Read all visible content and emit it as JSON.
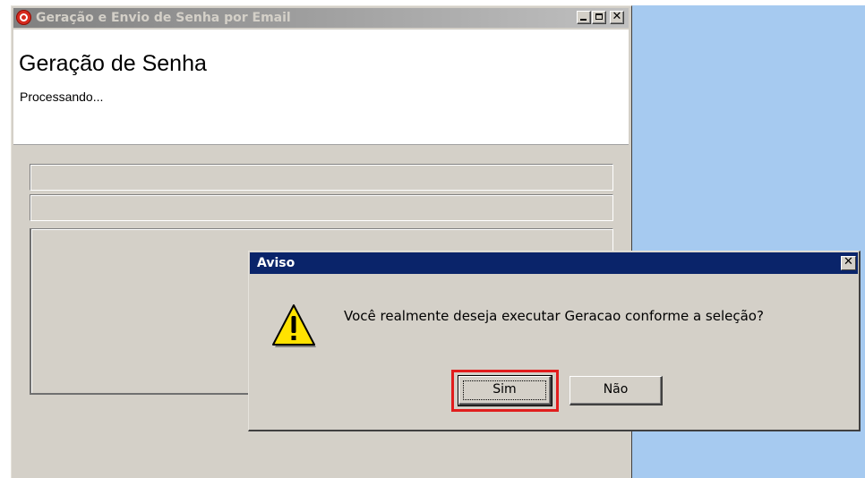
{
  "main_window": {
    "title": "Geração e Envio de Senha por Email",
    "header_title": "Geração de Senha",
    "status": "Processando...",
    "icon": "app-icon"
  },
  "dialog": {
    "title": "Aviso",
    "message": "Você realmente deseja executar Geracao conforme a seleção?",
    "icon": "warning-icon",
    "yes_label": "Sim",
    "no_label": "Não",
    "highlight_color": "#e11d1d"
  },
  "colors": {
    "desktop": "#a6caf0",
    "active_title": "#0a246a",
    "window_face": "#d4d0c8"
  }
}
